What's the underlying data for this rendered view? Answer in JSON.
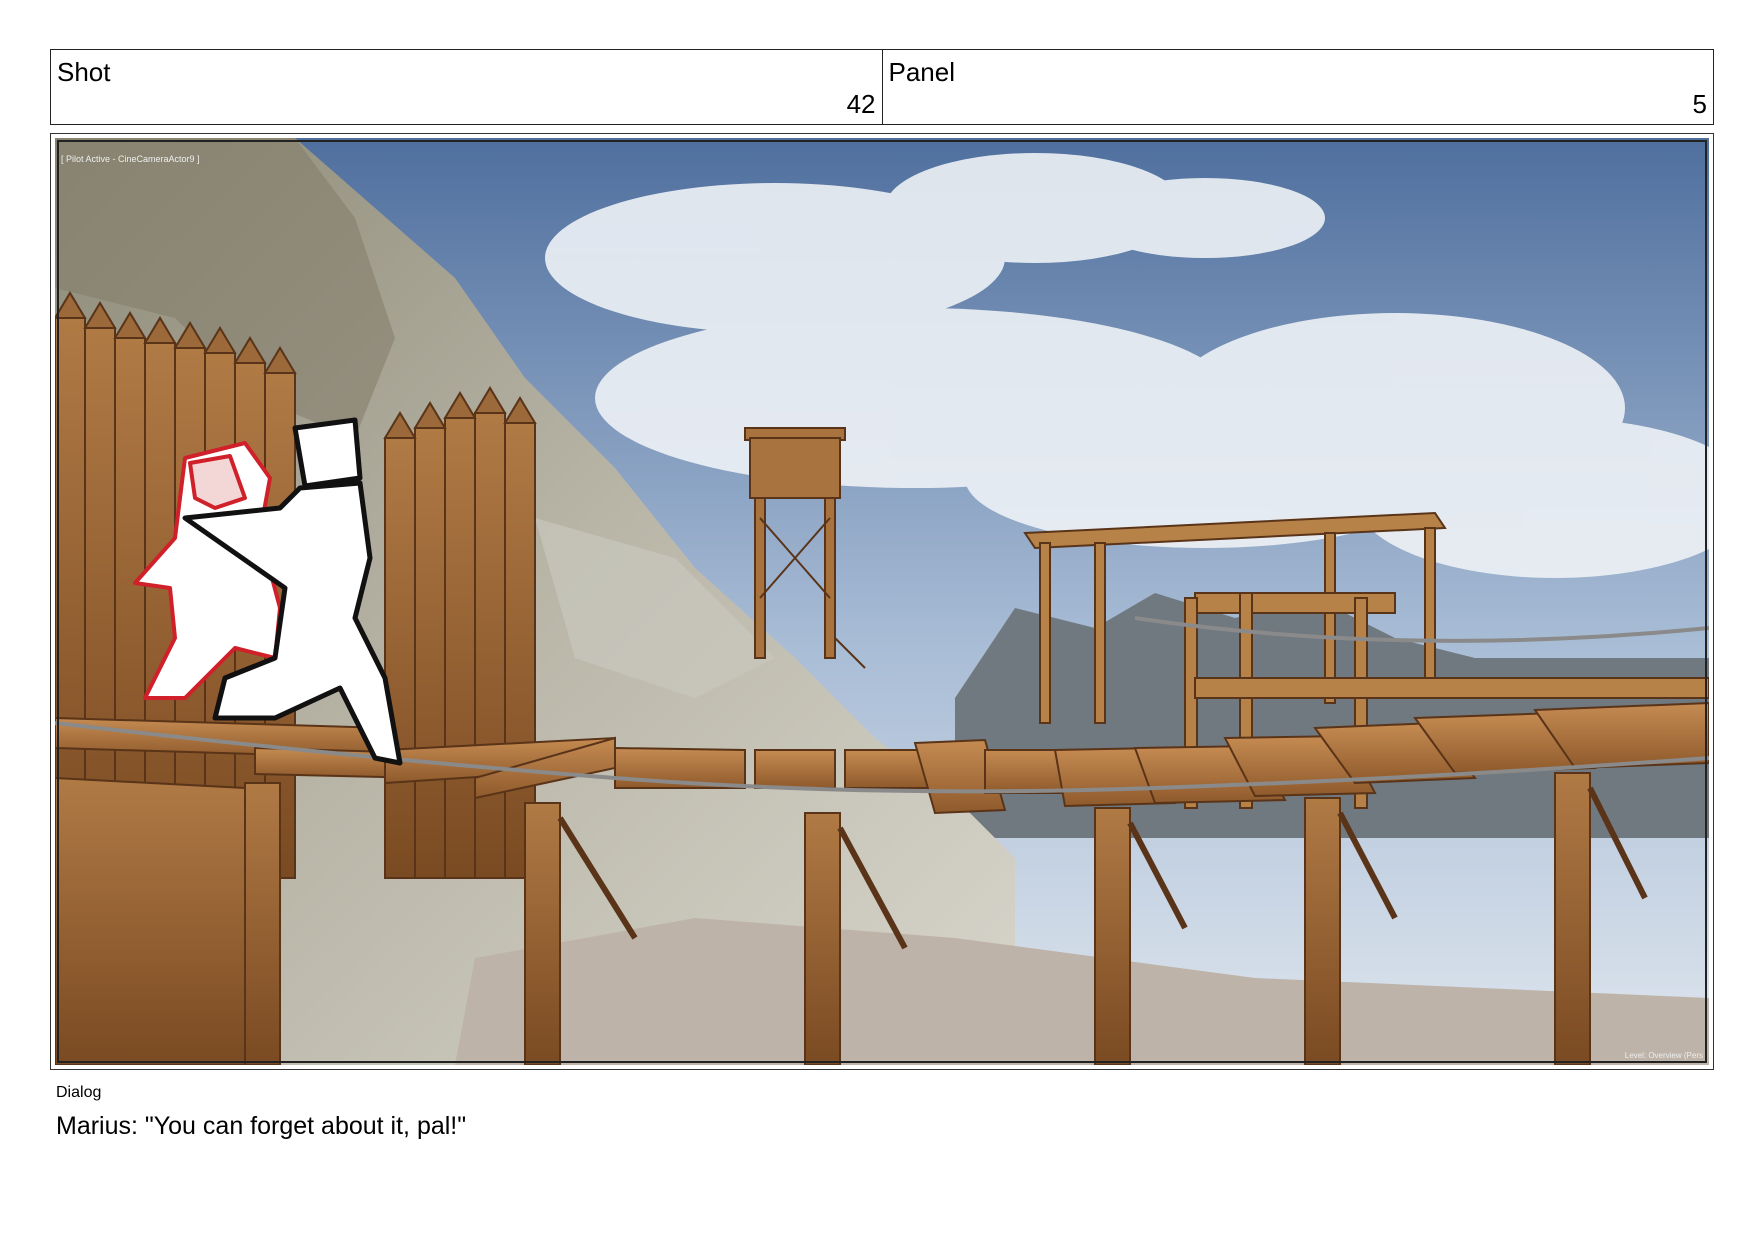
{
  "header": {
    "shot_label": "Shot",
    "shot_number": "42",
    "panel_label": "Panel",
    "panel_number": "5"
  },
  "viewport": {
    "overlay_top_left": "[ Pilot Active - CineCameraActor9 ]",
    "overlay_bottom_right": "Level: Overview (Pers"
  },
  "dialog": {
    "label": "Dialog",
    "text": "Marius: \"You can forget about it, pal!\""
  }
}
